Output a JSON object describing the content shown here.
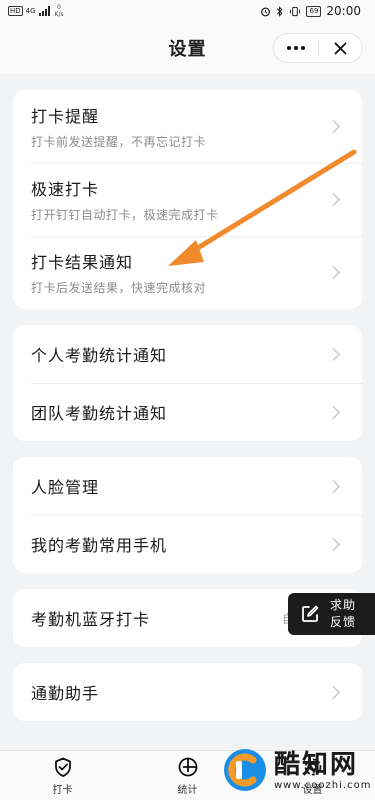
{
  "status_bar": {
    "hd": "HD",
    "network": "4G",
    "speed_value": "0",
    "speed_unit": "K/s",
    "battery": "69",
    "time": "20:00"
  },
  "nav": {
    "title": "设置"
  },
  "cards": [
    {
      "rows": [
        {
          "title": "打卡提醒",
          "subtitle": "打卡前发送提醒，不再忘记打卡"
        },
        {
          "title": "极速打卡",
          "subtitle": "打开钉钉自动打卡，极速完成打卡"
        },
        {
          "title": "打卡结果通知",
          "subtitle": "打卡后发送结果，快速完成核对"
        }
      ]
    },
    {
      "rows": [
        {
          "title": "个人考勤统计通知"
        },
        {
          "title": "团队考勤统计通知"
        }
      ]
    },
    {
      "rows": [
        {
          "title": "人脸管理"
        },
        {
          "title": "我的考勤常用手机"
        }
      ]
    },
    {
      "rows": [
        {
          "title": "考勤机蓝牙打卡",
          "hint": "自"
        }
      ]
    },
    {
      "rows": [
        {
          "title": "通勤助手"
        }
      ]
    }
  ],
  "help_float": {
    "line1": "求助",
    "line2": "反馈"
  },
  "tabs": [
    {
      "label": "打卡",
      "icon": "check-badge-icon"
    },
    {
      "label": "统计",
      "icon": "pie-chart-icon"
    },
    {
      "label": "设置",
      "icon": "gear-icon"
    }
  ],
  "watermark": {
    "name": "酷知网",
    "url": "www.coozhi.com"
  },
  "colors": {
    "annotation_arrow": "#f08a2c",
    "background": "#f2f3f5",
    "card": "#ffffff"
  }
}
